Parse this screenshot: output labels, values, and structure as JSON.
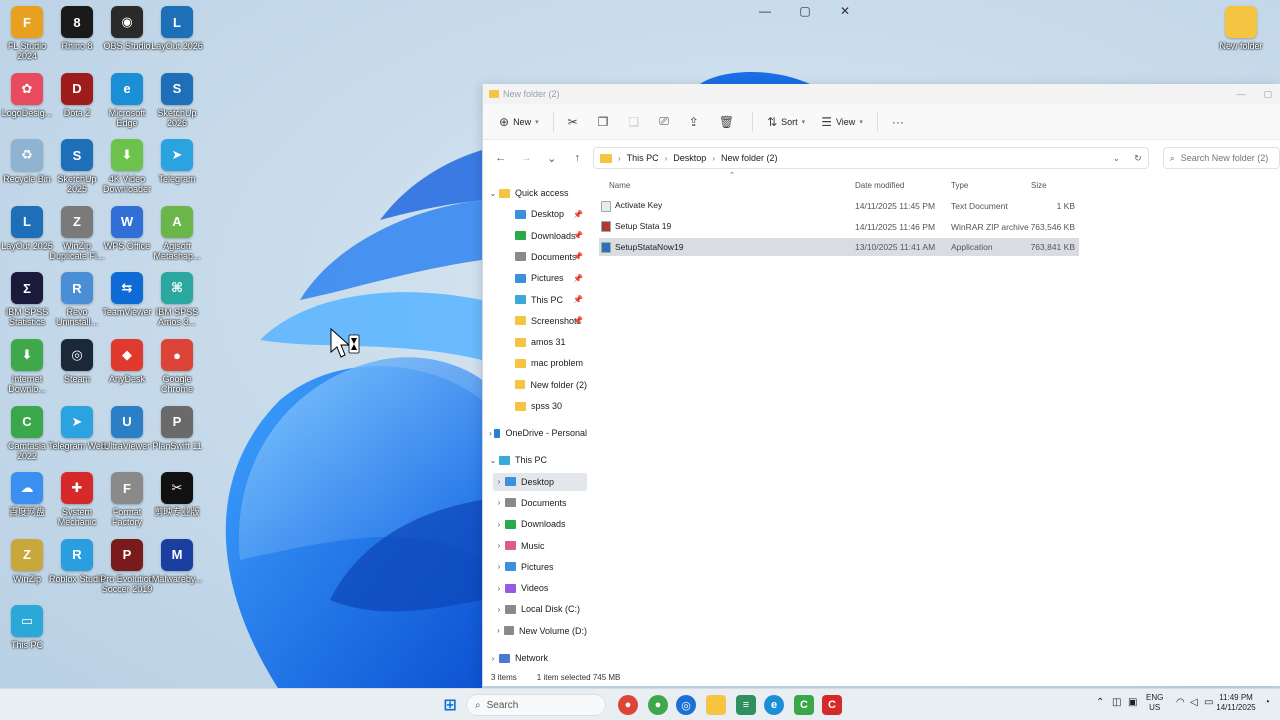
{
  "window_controls": {
    "minimize": "—",
    "maximize": "▢",
    "close": "✕"
  },
  "desktop_icons": [
    {
      "label": "FL Studio 2024",
      "glyph": "F",
      "color": "#e8a020"
    },
    {
      "label": "Rhino 8",
      "glyph": "8",
      "color": "#1a1a1a"
    },
    {
      "label": "OBS Studio",
      "glyph": "◉",
      "color": "#2a2a2a"
    },
    {
      "label": "LayOut 2026",
      "glyph": "L",
      "color": "#1d6fb8"
    },
    {
      "label": "LogoDesig...",
      "glyph": "✿",
      "color": "#e84a5f"
    },
    {
      "label": "Dota 2",
      "glyph": "D",
      "color": "#9e1c1c"
    },
    {
      "label": "Microsoft Edge",
      "glyph": "e",
      "color": "#1b8fd6"
    },
    {
      "label": "SketchUp 2026",
      "glyph": "S",
      "color": "#1d6fb8"
    },
    {
      "label": "Recycle Bin",
      "glyph": "♻",
      "color": "#8fb3d0"
    },
    {
      "label": "SketchUp 2025",
      "glyph": "S",
      "color": "#1d6fb8"
    },
    {
      "label": "4K Video Downloader",
      "glyph": "⬇",
      "color": "#6cc24a"
    },
    {
      "label": "Telegram",
      "glyph": "➤",
      "color": "#2aa3e0"
    },
    {
      "label": "LayOut 2025",
      "glyph": "L",
      "color": "#1d6fb8"
    },
    {
      "label": "WinZip Duplicate Fi...",
      "glyph": "Z",
      "color": "#7a7a7a"
    },
    {
      "label": "WPS Office",
      "glyph": "W",
      "color": "#2f6fd6"
    },
    {
      "label": "Agisoft Metashap...",
      "glyph": "A",
      "color": "#6bb64a"
    },
    {
      "label": "IBM SPSS Statistics",
      "glyph": "Σ",
      "color": "#1a1a3a"
    },
    {
      "label": "Revo Uninstall...",
      "glyph": "R",
      "color": "#4a8fd6"
    },
    {
      "label": "TeamViewer",
      "glyph": "⇆",
      "color": "#0e6bd6"
    },
    {
      "label": "IBM SPSS Amos 3...",
      "glyph": "⌘",
      "color": "#2aa8a0"
    },
    {
      "label": "Internet Downlo...",
      "glyph": "⬇",
      "color": "#3fa84a"
    },
    {
      "label": "Steam",
      "glyph": "◎",
      "color": "#1b2838"
    },
    {
      "label": "AnyDesk",
      "glyph": "◆",
      "color": "#e03a2e"
    },
    {
      "label": "Google Chrome",
      "glyph": "●",
      "color": "#db4437"
    },
    {
      "label": "Camtasia 2022",
      "glyph": "C",
      "color": "#3aa84a"
    },
    {
      "label": "Telegram Web",
      "glyph": "➤",
      "color": "#2aa3e0"
    },
    {
      "label": "UltraViewer",
      "glyph": "U",
      "color": "#2a7fc6"
    },
    {
      "label": "PlanSwift 11",
      "glyph": "P",
      "color": "#6a6a6a"
    },
    {
      "label": "百度网盘",
      "glyph": "☁",
      "color": "#3a8ff0"
    },
    {
      "label": "System Mechanic",
      "glyph": "✚",
      "color": "#d62a2a"
    },
    {
      "label": "Format Factory",
      "glyph": "F",
      "color": "#8a8a8a"
    },
    {
      "label": "剪映专业版",
      "glyph": "✂",
      "color": "#111111"
    },
    {
      "label": "WinZip",
      "glyph": "Z",
      "color": "#c8a83a"
    },
    {
      "label": "Roblox Studio",
      "glyph": "R",
      "color": "#2a9fe0"
    },
    {
      "label": "Pro Evolution Soccer 2019",
      "glyph": "P",
      "color": "#7a1a1a"
    },
    {
      "label": "Malwareby...",
      "glyph": "M",
      "color": "#1b3fa0"
    },
    {
      "label": "This PC",
      "glyph": "▭",
      "color": "#2aa8d8"
    },
    {
      "label": "New folder",
      "glyph": "",
      "color": "#f5c542"
    }
  ],
  "explorer": {
    "title": "New folder (2)",
    "toolbar": {
      "new": "New",
      "sort": "Sort",
      "view": "View",
      "more": "···"
    },
    "address": [
      "This PC",
      "Desktop",
      "New folder (2)"
    ],
    "search_placeholder": "Search New folder (2)",
    "nav": {
      "quick_access": "Quick access",
      "quick_items": [
        "Desktop",
        "Downloads",
        "Documents",
        "Pictures",
        "This PC",
        "Screenshots",
        "amos 31",
        "mac problem",
        "New folder (2)",
        "spss 30"
      ],
      "onedrive": "OneDrive - Personal",
      "this_pc": "This PC",
      "pc_items": [
        "Desktop",
        "Documents",
        "Downloads",
        "Music",
        "Pictures",
        "Videos",
        "Local Disk (C:)",
        "New Volume (D:)"
      ],
      "network": "Network"
    },
    "columns": {
      "name": "Name",
      "date": "Date modified",
      "type": "Type",
      "size": "Size"
    },
    "files": [
      {
        "name": "Activate Key",
        "date": "14/11/2025 11:45 PM",
        "type": "Text Document",
        "size": "1 KB"
      },
      {
        "name": "Setup Stata 19",
        "date": "14/11/2025 11:46 PM",
        "type": "WinRAR ZIP archive",
        "size": "763,546 KB"
      },
      {
        "name": "SetupStataNow19",
        "date": "13/10/2025 11:41 AM",
        "type": "Application",
        "size": "763,841 KB"
      }
    ],
    "status": {
      "count": "3 items",
      "selected": "1 item selected  745 MB"
    }
  },
  "taskbar": {
    "search": "Search",
    "lang": "ENG",
    "region": "US",
    "time": "11:49 PM",
    "date": "14/11/2025"
  }
}
